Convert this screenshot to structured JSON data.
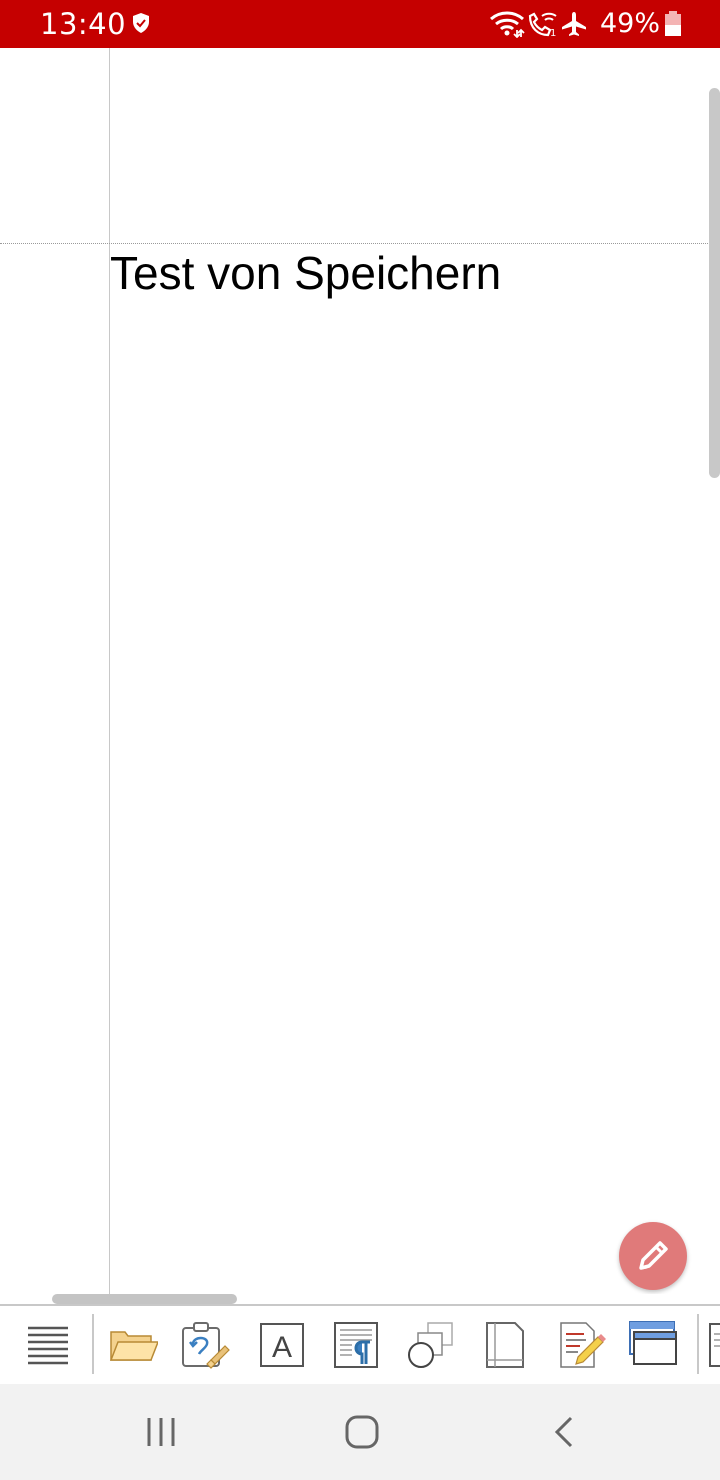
{
  "status_bar": {
    "time": "13:40",
    "battery_percent": "49%",
    "background_color": "#c50000",
    "icons": [
      "shield-icon",
      "wifi-icon",
      "wifi-call-icon",
      "airplane-icon",
      "battery-icon"
    ]
  },
  "document": {
    "text": "Test von Speichern"
  },
  "fab": {
    "icon": "pencil-icon",
    "color": "#e07a7a"
  },
  "toolbar": {
    "icons": [
      "menu-icon",
      "open-folder-icon",
      "clipboard-format-icon",
      "character-format-icon",
      "paragraph-format-icon",
      "shapes-icon",
      "page-layout-icon",
      "review-edit-icon",
      "window-view-icon",
      "more-icon"
    ]
  },
  "nav_bar": {
    "icons": [
      "recents-icon",
      "home-icon",
      "back-icon"
    ]
  }
}
